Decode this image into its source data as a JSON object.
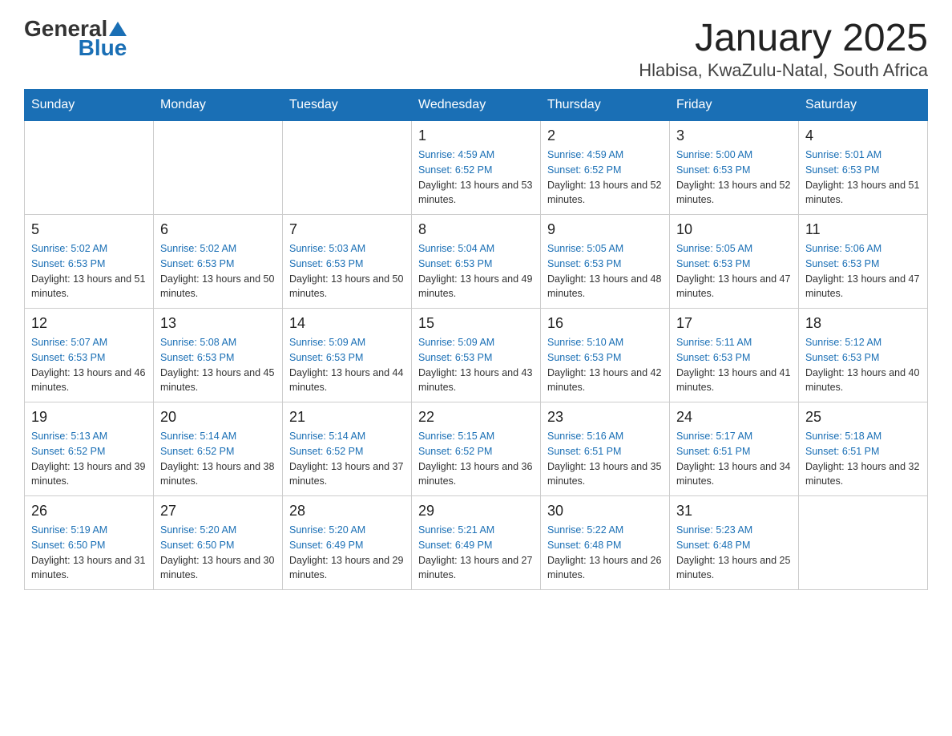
{
  "header": {
    "logo": {
      "general": "General",
      "blue": "Blue"
    },
    "title": "January 2025",
    "subtitle": "Hlabisa, KwaZulu-Natal, South Africa"
  },
  "weekdays": [
    "Sunday",
    "Monday",
    "Tuesday",
    "Wednesday",
    "Thursday",
    "Friday",
    "Saturday"
  ],
  "weeks": [
    [
      {
        "day": "",
        "info": ""
      },
      {
        "day": "",
        "info": ""
      },
      {
        "day": "",
        "info": ""
      },
      {
        "day": "1",
        "sunrise": "Sunrise: 4:59 AM",
        "sunset": "Sunset: 6:52 PM",
        "daylight": "Daylight: 13 hours and 53 minutes."
      },
      {
        "day": "2",
        "sunrise": "Sunrise: 4:59 AM",
        "sunset": "Sunset: 6:52 PM",
        "daylight": "Daylight: 13 hours and 52 minutes."
      },
      {
        "day": "3",
        "sunrise": "Sunrise: 5:00 AM",
        "sunset": "Sunset: 6:53 PM",
        "daylight": "Daylight: 13 hours and 52 minutes."
      },
      {
        "day": "4",
        "sunrise": "Sunrise: 5:01 AM",
        "sunset": "Sunset: 6:53 PM",
        "daylight": "Daylight: 13 hours and 51 minutes."
      }
    ],
    [
      {
        "day": "5",
        "sunrise": "Sunrise: 5:02 AM",
        "sunset": "Sunset: 6:53 PM",
        "daylight": "Daylight: 13 hours and 51 minutes."
      },
      {
        "day": "6",
        "sunrise": "Sunrise: 5:02 AM",
        "sunset": "Sunset: 6:53 PM",
        "daylight": "Daylight: 13 hours and 50 minutes."
      },
      {
        "day": "7",
        "sunrise": "Sunrise: 5:03 AM",
        "sunset": "Sunset: 6:53 PM",
        "daylight": "Daylight: 13 hours and 50 minutes."
      },
      {
        "day": "8",
        "sunrise": "Sunrise: 5:04 AM",
        "sunset": "Sunset: 6:53 PM",
        "daylight": "Daylight: 13 hours and 49 minutes."
      },
      {
        "day": "9",
        "sunrise": "Sunrise: 5:05 AM",
        "sunset": "Sunset: 6:53 PM",
        "daylight": "Daylight: 13 hours and 48 minutes."
      },
      {
        "day": "10",
        "sunrise": "Sunrise: 5:05 AM",
        "sunset": "Sunset: 6:53 PM",
        "daylight": "Daylight: 13 hours and 47 minutes."
      },
      {
        "day": "11",
        "sunrise": "Sunrise: 5:06 AM",
        "sunset": "Sunset: 6:53 PM",
        "daylight": "Daylight: 13 hours and 47 minutes."
      }
    ],
    [
      {
        "day": "12",
        "sunrise": "Sunrise: 5:07 AM",
        "sunset": "Sunset: 6:53 PM",
        "daylight": "Daylight: 13 hours and 46 minutes."
      },
      {
        "day": "13",
        "sunrise": "Sunrise: 5:08 AM",
        "sunset": "Sunset: 6:53 PM",
        "daylight": "Daylight: 13 hours and 45 minutes."
      },
      {
        "day": "14",
        "sunrise": "Sunrise: 5:09 AM",
        "sunset": "Sunset: 6:53 PM",
        "daylight": "Daylight: 13 hours and 44 minutes."
      },
      {
        "day": "15",
        "sunrise": "Sunrise: 5:09 AM",
        "sunset": "Sunset: 6:53 PM",
        "daylight": "Daylight: 13 hours and 43 minutes."
      },
      {
        "day": "16",
        "sunrise": "Sunrise: 5:10 AM",
        "sunset": "Sunset: 6:53 PM",
        "daylight": "Daylight: 13 hours and 42 minutes."
      },
      {
        "day": "17",
        "sunrise": "Sunrise: 5:11 AM",
        "sunset": "Sunset: 6:53 PM",
        "daylight": "Daylight: 13 hours and 41 minutes."
      },
      {
        "day": "18",
        "sunrise": "Sunrise: 5:12 AM",
        "sunset": "Sunset: 6:53 PM",
        "daylight": "Daylight: 13 hours and 40 minutes."
      }
    ],
    [
      {
        "day": "19",
        "sunrise": "Sunrise: 5:13 AM",
        "sunset": "Sunset: 6:52 PM",
        "daylight": "Daylight: 13 hours and 39 minutes."
      },
      {
        "day": "20",
        "sunrise": "Sunrise: 5:14 AM",
        "sunset": "Sunset: 6:52 PM",
        "daylight": "Daylight: 13 hours and 38 minutes."
      },
      {
        "day": "21",
        "sunrise": "Sunrise: 5:14 AM",
        "sunset": "Sunset: 6:52 PM",
        "daylight": "Daylight: 13 hours and 37 minutes."
      },
      {
        "day": "22",
        "sunrise": "Sunrise: 5:15 AM",
        "sunset": "Sunset: 6:52 PM",
        "daylight": "Daylight: 13 hours and 36 minutes."
      },
      {
        "day": "23",
        "sunrise": "Sunrise: 5:16 AM",
        "sunset": "Sunset: 6:51 PM",
        "daylight": "Daylight: 13 hours and 35 minutes."
      },
      {
        "day": "24",
        "sunrise": "Sunrise: 5:17 AM",
        "sunset": "Sunset: 6:51 PM",
        "daylight": "Daylight: 13 hours and 34 minutes."
      },
      {
        "day": "25",
        "sunrise": "Sunrise: 5:18 AM",
        "sunset": "Sunset: 6:51 PM",
        "daylight": "Daylight: 13 hours and 32 minutes."
      }
    ],
    [
      {
        "day": "26",
        "sunrise": "Sunrise: 5:19 AM",
        "sunset": "Sunset: 6:50 PM",
        "daylight": "Daylight: 13 hours and 31 minutes."
      },
      {
        "day": "27",
        "sunrise": "Sunrise: 5:20 AM",
        "sunset": "Sunset: 6:50 PM",
        "daylight": "Daylight: 13 hours and 30 minutes."
      },
      {
        "day": "28",
        "sunrise": "Sunrise: 5:20 AM",
        "sunset": "Sunset: 6:49 PM",
        "daylight": "Daylight: 13 hours and 29 minutes."
      },
      {
        "day": "29",
        "sunrise": "Sunrise: 5:21 AM",
        "sunset": "Sunset: 6:49 PM",
        "daylight": "Daylight: 13 hours and 27 minutes."
      },
      {
        "day": "30",
        "sunrise": "Sunrise: 5:22 AM",
        "sunset": "Sunset: 6:48 PM",
        "daylight": "Daylight: 13 hours and 26 minutes."
      },
      {
        "day": "31",
        "sunrise": "Sunrise: 5:23 AM",
        "sunset": "Sunset: 6:48 PM",
        "daylight": "Daylight: 13 hours and 25 minutes."
      },
      {
        "day": "",
        "info": ""
      }
    ]
  ]
}
